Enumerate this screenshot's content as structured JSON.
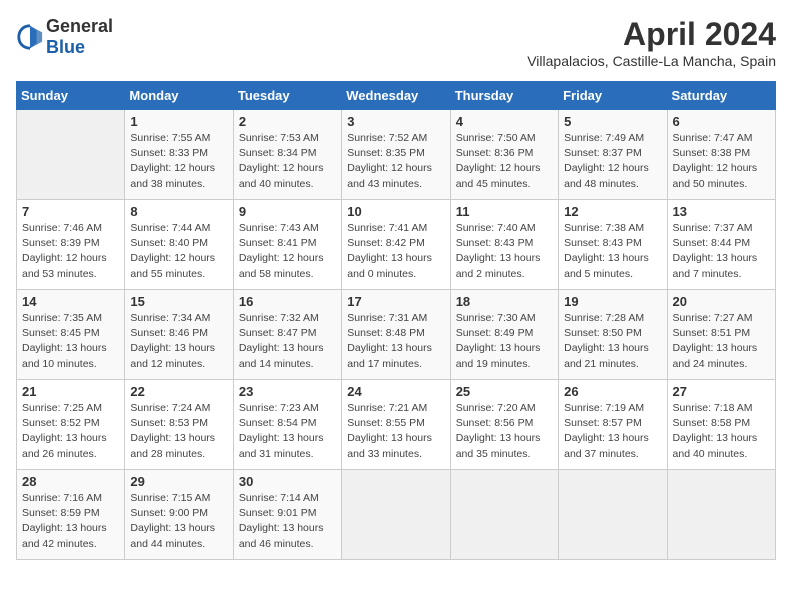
{
  "header": {
    "logo_general": "General",
    "logo_blue": "Blue",
    "month": "April 2024",
    "location": "Villapalacios, Castille-La Mancha, Spain"
  },
  "weekdays": [
    "Sunday",
    "Monday",
    "Tuesday",
    "Wednesday",
    "Thursday",
    "Friday",
    "Saturday"
  ],
  "weeks": [
    [
      {
        "day": "",
        "empty": true
      },
      {
        "day": "1",
        "sunrise": "Sunrise: 7:55 AM",
        "sunset": "Sunset: 8:33 PM",
        "daylight": "Daylight: 12 hours and 38 minutes."
      },
      {
        "day": "2",
        "sunrise": "Sunrise: 7:53 AM",
        "sunset": "Sunset: 8:34 PM",
        "daylight": "Daylight: 12 hours and 40 minutes."
      },
      {
        "day": "3",
        "sunrise": "Sunrise: 7:52 AM",
        "sunset": "Sunset: 8:35 PM",
        "daylight": "Daylight: 12 hours and 43 minutes."
      },
      {
        "day": "4",
        "sunrise": "Sunrise: 7:50 AM",
        "sunset": "Sunset: 8:36 PM",
        "daylight": "Daylight: 12 hours and 45 minutes."
      },
      {
        "day": "5",
        "sunrise": "Sunrise: 7:49 AM",
        "sunset": "Sunset: 8:37 PM",
        "daylight": "Daylight: 12 hours and 48 minutes."
      },
      {
        "day": "6",
        "sunrise": "Sunrise: 7:47 AM",
        "sunset": "Sunset: 8:38 PM",
        "daylight": "Daylight: 12 hours and 50 minutes."
      }
    ],
    [
      {
        "day": "7",
        "sunrise": "Sunrise: 7:46 AM",
        "sunset": "Sunset: 8:39 PM",
        "daylight": "Daylight: 12 hours and 53 minutes."
      },
      {
        "day": "8",
        "sunrise": "Sunrise: 7:44 AM",
        "sunset": "Sunset: 8:40 PM",
        "daylight": "Daylight: 12 hours and 55 minutes."
      },
      {
        "day": "9",
        "sunrise": "Sunrise: 7:43 AM",
        "sunset": "Sunset: 8:41 PM",
        "daylight": "Daylight: 12 hours and 58 minutes."
      },
      {
        "day": "10",
        "sunrise": "Sunrise: 7:41 AM",
        "sunset": "Sunset: 8:42 PM",
        "daylight": "Daylight: 13 hours and 0 minutes."
      },
      {
        "day": "11",
        "sunrise": "Sunrise: 7:40 AM",
        "sunset": "Sunset: 8:43 PM",
        "daylight": "Daylight: 13 hours and 2 minutes."
      },
      {
        "day": "12",
        "sunrise": "Sunrise: 7:38 AM",
        "sunset": "Sunset: 8:43 PM",
        "daylight": "Daylight: 13 hours and 5 minutes."
      },
      {
        "day": "13",
        "sunrise": "Sunrise: 7:37 AM",
        "sunset": "Sunset: 8:44 PM",
        "daylight": "Daylight: 13 hours and 7 minutes."
      }
    ],
    [
      {
        "day": "14",
        "sunrise": "Sunrise: 7:35 AM",
        "sunset": "Sunset: 8:45 PM",
        "daylight": "Daylight: 13 hours and 10 minutes."
      },
      {
        "day": "15",
        "sunrise": "Sunrise: 7:34 AM",
        "sunset": "Sunset: 8:46 PM",
        "daylight": "Daylight: 13 hours and 12 minutes."
      },
      {
        "day": "16",
        "sunrise": "Sunrise: 7:32 AM",
        "sunset": "Sunset: 8:47 PM",
        "daylight": "Daylight: 13 hours and 14 minutes."
      },
      {
        "day": "17",
        "sunrise": "Sunrise: 7:31 AM",
        "sunset": "Sunset: 8:48 PM",
        "daylight": "Daylight: 13 hours and 17 minutes."
      },
      {
        "day": "18",
        "sunrise": "Sunrise: 7:30 AM",
        "sunset": "Sunset: 8:49 PM",
        "daylight": "Daylight: 13 hours and 19 minutes."
      },
      {
        "day": "19",
        "sunrise": "Sunrise: 7:28 AM",
        "sunset": "Sunset: 8:50 PM",
        "daylight": "Daylight: 13 hours and 21 minutes."
      },
      {
        "day": "20",
        "sunrise": "Sunrise: 7:27 AM",
        "sunset": "Sunset: 8:51 PM",
        "daylight": "Daylight: 13 hours and 24 minutes."
      }
    ],
    [
      {
        "day": "21",
        "sunrise": "Sunrise: 7:25 AM",
        "sunset": "Sunset: 8:52 PM",
        "daylight": "Daylight: 13 hours and 26 minutes."
      },
      {
        "day": "22",
        "sunrise": "Sunrise: 7:24 AM",
        "sunset": "Sunset: 8:53 PM",
        "daylight": "Daylight: 13 hours and 28 minutes."
      },
      {
        "day": "23",
        "sunrise": "Sunrise: 7:23 AM",
        "sunset": "Sunset: 8:54 PM",
        "daylight": "Daylight: 13 hours and 31 minutes."
      },
      {
        "day": "24",
        "sunrise": "Sunrise: 7:21 AM",
        "sunset": "Sunset: 8:55 PM",
        "daylight": "Daylight: 13 hours and 33 minutes."
      },
      {
        "day": "25",
        "sunrise": "Sunrise: 7:20 AM",
        "sunset": "Sunset: 8:56 PM",
        "daylight": "Daylight: 13 hours and 35 minutes."
      },
      {
        "day": "26",
        "sunrise": "Sunrise: 7:19 AM",
        "sunset": "Sunset: 8:57 PM",
        "daylight": "Daylight: 13 hours and 37 minutes."
      },
      {
        "day": "27",
        "sunrise": "Sunrise: 7:18 AM",
        "sunset": "Sunset: 8:58 PM",
        "daylight": "Daylight: 13 hours and 40 minutes."
      }
    ],
    [
      {
        "day": "28",
        "sunrise": "Sunrise: 7:16 AM",
        "sunset": "Sunset: 8:59 PM",
        "daylight": "Daylight: 13 hours and 42 minutes."
      },
      {
        "day": "29",
        "sunrise": "Sunrise: 7:15 AM",
        "sunset": "Sunset: 9:00 PM",
        "daylight": "Daylight: 13 hours and 44 minutes."
      },
      {
        "day": "30",
        "sunrise": "Sunrise: 7:14 AM",
        "sunset": "Sunset: 9:01 PM",
        "daylight": "Daylight: 13 hours and 46 minutes."
      },
      {
        "day": "",
        "empty": true
      },
      {
        "day": "",
        "empty": true
      },
      {
        "day": "",
        "empty": true
      },
      {
        "day": "",
        "empty": true
      }
    ]
  ]
}
